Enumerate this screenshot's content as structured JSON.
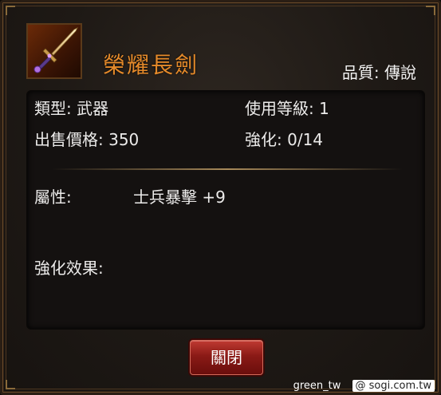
{
  "item": {
    "name": "榮耀長劍",
    "quality_label": "品質:",
    "quality_value": "傳說",
    "icon": "sword-icon"
  },
  "stats": {
    "type_label": "類型:",
    "type_value": "武器",
    "level_label": "使用等級:",
    "level_value": "1",
    "price_label": "出售價格:",
    "price_value": "350",
    "enhance_label": "強化:",
    "enhance_value": "0/14"
  },
  "attributes": {
    "label": "屬性:",
    "value": "士兵暴擊 +9"
  },
  "enhance_effect": {
    "label": "強化效果:",
    "value": ""
  },
  "buttons": {
    "close_label": "關閉"
  },
  "watermark": {
    "user": "green_tw",
    "site": "@ sogi.com.tw"
  },
  "colors": {
    "item_name": "#e58a2a",
    "button_red": "#8a1a16"
  }
}
